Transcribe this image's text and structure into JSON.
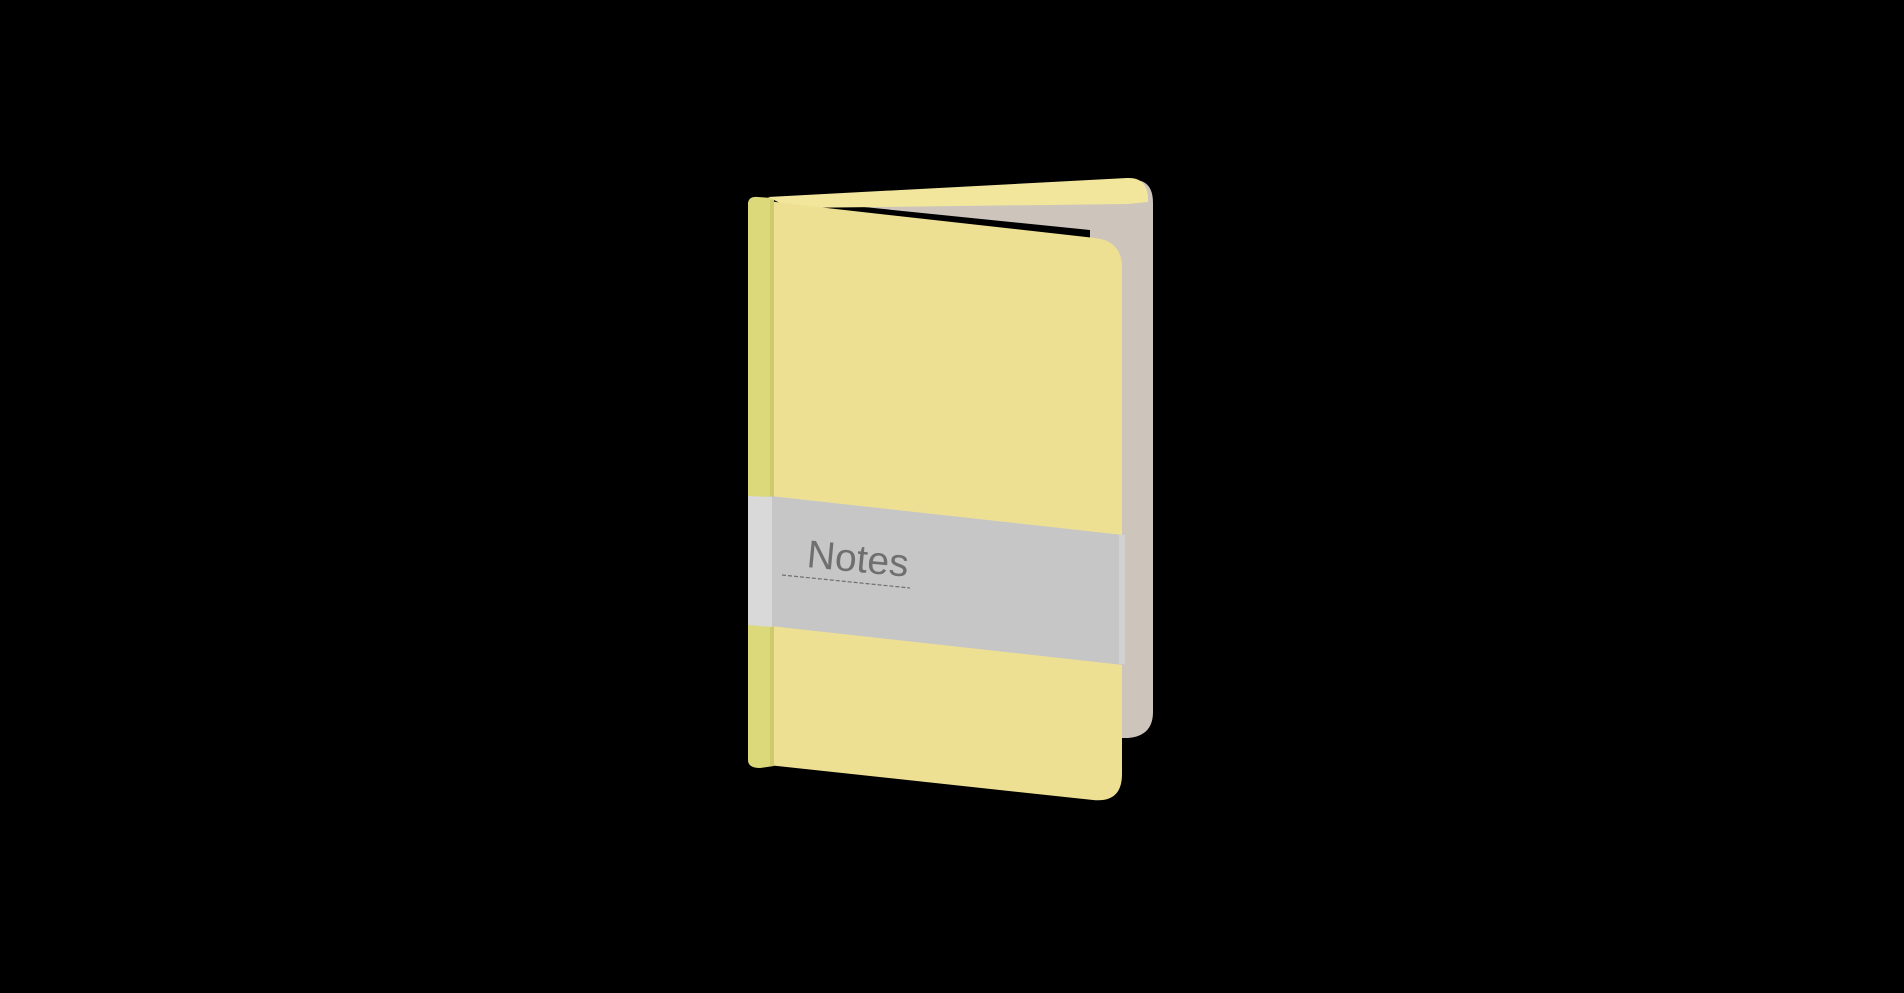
{
  "notebook": {
    "label_text": "Notes",
    "colors": {
      "background": "#000000",
      "cover": "#EEE093",
      "cover_top_edge": "#F2E69C",
      "spine": "#DCD97A",
      "spine_shadow": "#CFCB6C",
      "pages": "#CDC5BB",
      "band": "#C6C6C6",
      "band_spine": "#D9D9D9",
      "band_edge": "#D2D2D2",
      "label_text": "#6F6F6F",
      "dashed_line": "#6F6F6F"
    }
  }
}
